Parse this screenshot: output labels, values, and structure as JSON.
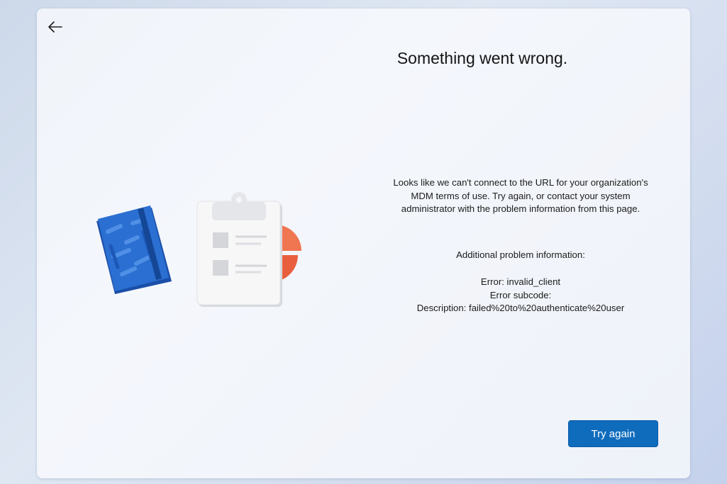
{
  "header": {
    "back_icon": "arrow-left-icon"
  },
  "main": {
    "title": "Something went wrong.",
    "message": "Looks like we can't connect to the URL for your organization's MDM terms of use. Try again, or contact your system administrator with the problem information from this page.",
    "info_header": "Additional problem information:",
    "error_lines": [
      "Error: invalid_client",
      "Error subcode:",
      "Description: failed%20to%20authenticate%20user"
    ]
  },
  "footer": {
    "try_again_label": "Try again"
  },
  "illustration": {
    "items": [
      "notebook-icon",
      "clipboard-icon",
      "pie-chart-icon"
    ],
    "colors": {
      "notebook": "#1e63c3",
      "pie": "#ef6a4a",
      "button": "#0f6cbd"
    }
  }
}
